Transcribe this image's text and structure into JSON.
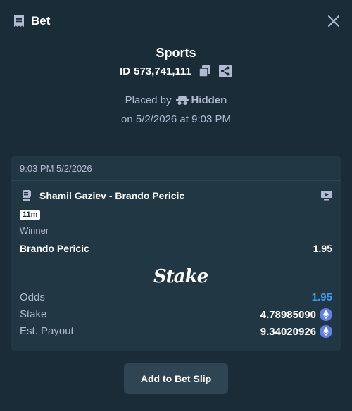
{
  "header": {
    "title": "Bet",
    "icon": "bet-slip-icon",
    "close_icon": "close-icon"
  },
  "bet": {
    "sport": "Sports",
    "id_label": "ID",
    "id_value": "573,741,111",
    "placed_by_label": "Placed by",
    "placed_by_user": "Hidden",
    "placed_on": "on 5/2/2026 at 9:03 PM"
  },
  "card": {
    "timestamp": "9:03 PM 5/2/2026",
    "match": "Shamil Gaziev - Brando Pericic",
    "time_badge": "11m",
    "market": "Winner",
    "selection": "Brando Pericic",
    "selection_odds": "1.95",
    "logo_text": "Stake",
    "details": {
      "odds_label": "Odds",
      "odds_value": "1.95",
      "stake_label": "Stake",
      "stake_value": "4.78985090",
      "payout_label": "Est. Payout",
      "payout_value": "9.34020926",
      "currency_icon": "ethereum-icon"
    }
  },
  "actions": {
    "add_to_slip": "Add to Bet Slip"
  },
  "colors": {
    "background": "#1a2c38",
    "card": "#213743",
    "muted_text": "#b1bad3",
    "accent_blue": "#3a9eee",
    "button": "#2f4553",
    "eth": "#627eea"
  }
}
